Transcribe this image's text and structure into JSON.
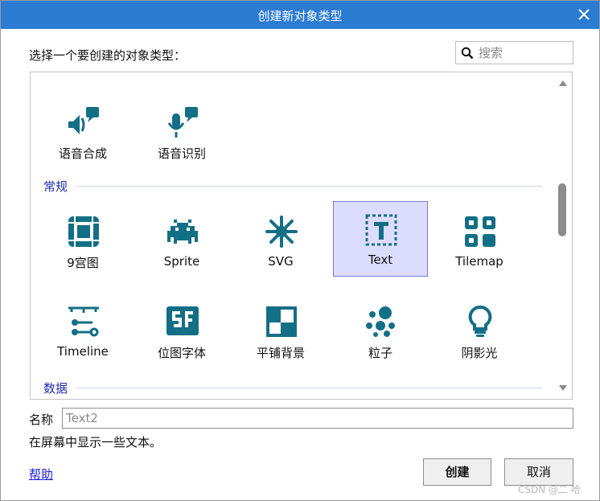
{
  "window": {
    "title": "创建新对象类型",
    "titlebar_color": "#2b7bd3",
    "close_icon": "close-icon"
  },
  "prompt": "选择一个要创建的对象类型：",
  "search": {
    "placeholder": "搜索",
    "value": ""
  },
  "list": {
    "row0": [
      {
        "id": "tts",
        "label": "语音合成",
        "icon": "speaker-speech-icon"
      },
      {
        "id": "stt",
        "label": "语音识别",
        "icon": "microphone-speech-icon"
      }
    ],
    "section_general": "常规",
    "row1": [
      {
        "id": "9patch",
        "label": "9宫图",
        "icon": "nine-patch-icon"
      },
      {
        "id": "sprite",
        "label": "Sprite",
        "icon": "space-invader-icon"
      },
      {
        "id": "svg",
        "label": "SVG",
        "icon": "asterisk-icon"
      },
      {
        "id": "text",
        "label": "Text",
        "icon": "text-box-icon",
        "selected": true
      },
      {
        "id": "tilemap",
        "label": "Tilemap",
        "icon": "grid-tiles-icon"
      }
    ],
    "row2": [
      {
        "id": "timeline",
        "label": "Timeline",
        "icon": "timeline-icon"
      },
      {
        "id": "bitmapfont",
        "label": "位图字体",
        "icon": "sf-font-icon"
      },
      {
        "id": "tiledbg",
        "label": "平铺背景",
        "icon": "checker-tile-icon"
      },
      {
        "id": "particles",
        "label": "粒子",
        "icon": "particles-icon"
      },
      {
        "id": "shadow",
        "label": "阴影光",
        "icon": "lightbulb-icon"
      }
    ],
    "section_data": "数据"
  },
  "name": {
    "label": "名称",
    "placeholder": "Text2",
    "value": ""
  },
  "description": "在屏幕中显示一些文本。",
  "help_link": "帮助",
  "buttons": {
    "create": "创建",
    "cancel": "取消"
  },
  "watermark": "CSDN @二 哈",
  "colors": {
    "icon_teal": "#136f86",
    "section_text": "#1f2fa8",
    "selected_bg": "#dcdcfe",
    "selected_border": "#7a7ad8",
    "link": "#1c22d8"
  }
}
